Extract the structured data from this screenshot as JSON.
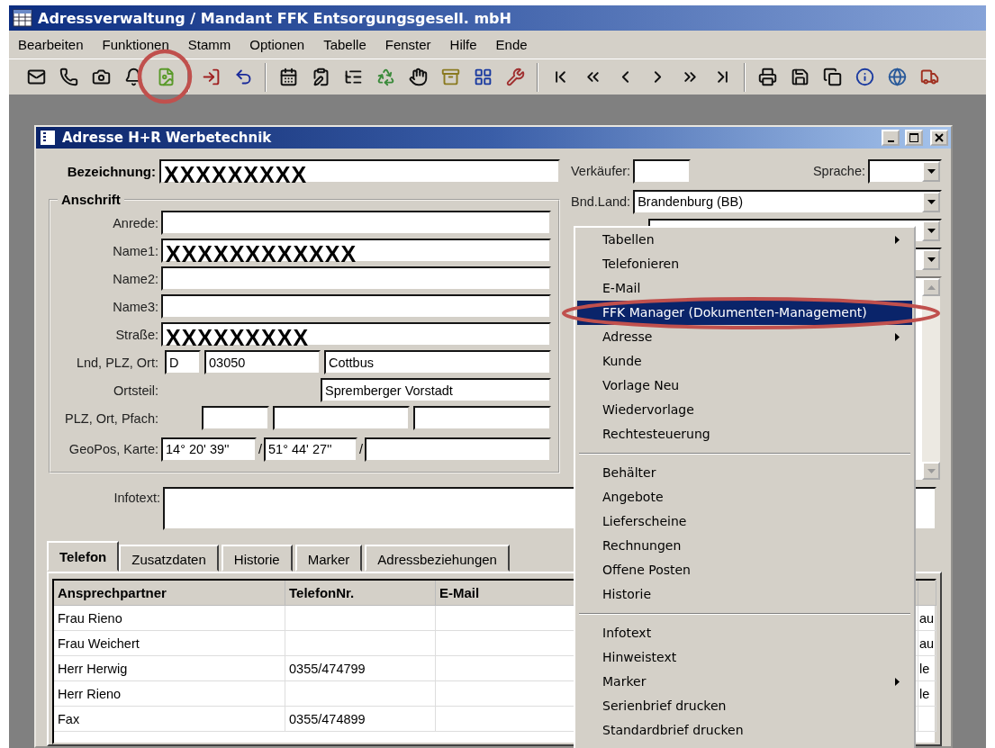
{
  "app_window": {
    "title": "Adressverwaltung / Mandant FFK Entsorgungsgesell. mbH"
  },
  "menu_bar": [
    "Bearbeiten",
    "Funktionen",
    "Stamm",
    "Optionen",
    "Tabelle",
    "Fenster",
    "Hilfe",
    "Ende"
  ],
  "address_window": {
    "title": "Adresse H+R Werbetechnik",
    "designation": {
      "label": "Bezeichnung:",
      "value": "XXXXXXXXX",
      "redacted": true
    },
    "address_group": {
      "title": "Anschrift",
      "rows": [
        {
          "kind": "text",
          "label": "Anrede:"
        },
        {
          "kind": "text",
          "label": "Name1:",
          "value": "XXXXXXXXXXXX",
          "redacted": true
        },
        {
          "kind": "text",
          "label": "Name2:"
        },
        {
          "kind": "text",
          "label": "Name3:"
        },
        {
          "kind": "text",
          "label": "Straße:",
          "value": "XXXXXXXXX",
          "redacted": true
        },
        {
          "kind": "place",
          "label": "Lnd, PLZ, Ort:",
          "country": "D",
          "zip": "03050",
          "city": "Cottbus"
        },
        {
          "kind": "district",
          "label": "Ortsteil:",
          "value": "Spremberger Vorstadt"
        },
        {
          "kind": "pobox",
          "label": "PLZ, Ort, Pfach:"
        },
        {
          "kind": "geo",
          "label": "GeoPos, Karte:",
          "longitude": "14° 20' 39''",
          "latitude": "51° 44' 27''",
          "separators": [
            "/",
            "/"
          ]
        }
      ]
    },
    "seller": {
      "label": "Verkäufer:"
    },
    "language": {
      "label": "Sprache:"
    },
    "federal_state": {
      "label": "Bnd.Land:",
      "value": "Brandenburg (BB)"
    },
    "infotext": {
      "label": "Infotext:"
    },
    "tabs": [
      {
        "label": "Telefon",
        "selected": true
      },
      {
        "label": "Zusatzdaten",
        "selected": false
      },
      {
        "label": "Historie",
        "selected": false
      },
      {
        "label": "Marker",
        "selected": false
      },
      {
        "label": "Adressbeziehungen",
        "selected": false
      }
    ],
    "contacts_table": {
      "columns": [
        "Ansprechpartner",
        "TelefonNr.",
        "E-Mail"
      ],
      "rows": [
        {
          "contact": "Frau Rieno",
          "column_4": "au"
        },
        {
          "contact": "Frau Weichert",
          "column_4": "au"
        },
        {
          "contact": "Herr Herwig",
          "phone": "0355/474799",
          "column_4": "le"
        },
        {
          "contact": "Herr Rieno",
          "column_4": "le"
        },
        {
          "contact": "Fax",
          "phone": "0355/474899"
        }
      ]
    }
  },
  "context_menu": {
    "groups": [
      [
        {
          "label": "Tabellen",
          "submenu": true,
          "selected": false
        },
        {
          "label": "Telefonieren",
          "submenu": false,
          "selected": false
        },
        {
          "label": "E-Mail",
          "submenu": false,
          "selected": false
        },
        {
          "label": "FFK Manager (Dokumenten-Management)",
          "submenu": false,
          "selected": true
        },
        {
          "label": "Adresse",
          "submenu": true,
          "selected": false
        },
        {
          "label": "Kunde",
          "submenu": false,
          "selected": false
        },
        {
          "label": "Vorlage Neu",
          "submenu": false,
          "selected": false
        },
        {
          "label": "Wiedervorlage",
          "submenu": false,
          "selected": false
        },
        {
          "label": "Rechtesteuerung",
          "submenu": false,
          "selected": false
        }
      ],
      [
        {
          "label": "Behälter",
          "submenu": false,
          "selected": false
        },
        {
          "label": "Angebote",
          "submenu": false,
          "selected": false
        },
        {
          "label": "Lieferscheine",
          "submenu": false,
          "selected": false
        },
        {
          "label": "Rechnungen",
          "submenu": false,
          "selected": false
        },
        {
          "label": "Offene Posten",
          "submenu": false,
          "selected": false
        },
        {
          "label": "Historie",
          "submenu": false,
          "selected": false
        }
      ],
      [
        {
          "label": "Infotext",
          "submenu": false,
          "selected": false
        },
        {
          "label": "Hinweistext",
          "submenu": false,
          "selected": false
        },
        {
          "label": "Marker",
          "submenu": true,
          "selected": false
        },
        {
          "label": "Serienbrief drucken",
          "submenu": false,
          "selected": false
        },
        {
          "label": "Standardbrief drucken",
          "submenu": false,
          "selected": false
        }
      ]
    ]
  }
}
